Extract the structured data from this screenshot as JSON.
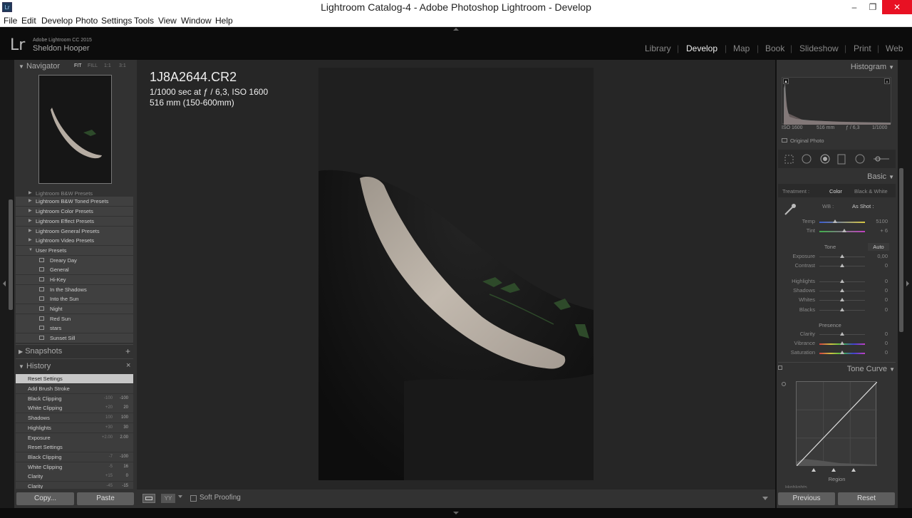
{
  "window": {
    "title": "Lightroom Catalog-4 - Adobe Photoshop Lightroom - Develop",
    "app_icon": "Lr",
    "minimize": "–",
    "maximize": "❐",
    "close": "✕"
  },
  "menu": [
    "File",
    "Edit",
    "Develop",
    "Photo",
    "Settings",
    "Tools",
    "View",
    "Window",
    "Help"
  ],
  "identity": {
    "logo": "Lr",
    "version": "Adobe Lightroom CC 2015",
    "user": "Sheldon Hooper"
  },
  "modules": [
    "Library",
    "Develop",
    "Map",
    "Book",
    "Slideshow",
    "Print",
    "Web"
  ],
  "navigator": {
    "title": "Navigator",
    "zoom": [
      "FIT",
      "FILL",
      "1:1",
      "3:1"
    ]
  },
  "presets": {
    "cut_top": "Lightroom B&W Presets",
    "folders": [
      "Lightroom B&W Toned Presets",
      "Lightroom Color Presets",
      "Lightroom Effect Presets",
      "Lightroom General Presets",
      "Lightroom Video Presets",
      "User Presets"
    ],
    "user": [
      "Dreary Day",
      "General",
      "Hi-Key",
      "In the Shadows",
      "Into the Sun",
      "Night",
      "Red Sun",
      "stars",
      "Sunset Sill"
    ]
  },
  "snapshots": {
    "title": "Snapshots",
    "add": "+"
  },
  "history": {
    "title": "History",
    "clear": "×",
    "items": [
      {
        "label": "Reset Settings",
        "v1": "",
        "v2": ""
      },
      {
        "label": "Add Brush Stroke",
        "v1": "",
        "v2": ""
      },
      {
        "label": "Black Clipping",
        "v1": "-100",
        "v2": "-100"
      },
      {
        "label": "White Clipping",
        "v1": "+20",
        "v2": "20"
      },
      {
        "label": "Shadows",
        "v1": "100",
        "v2": "100"
      },
      {
        "label": "Highlights",
        "v1": "+30",
        "v2": "30"
      },
      {
        "label": "Exposure",
        "v1": "+2.00",
        "v2": "2.00"
      },
      {
        "label": "Reset Settings",
        "v1": "",
        "v2": ""
      },
      {
        "label": "Black Clipping",
        "v1": "-7",
        "v2": "-100"
      },
      {
        "label": "White Clipping",
        "v1": "-5",
        "v2": "16"
      },
      {
        "label": "Clarity",
        "v1": "+15",
        "v2": "0"
      },
      {
        "label": "Clarity",
        "v1": "-45",
        "v2": "-15"
      }
    ]
  },
  "left_buttons": {
    "copy": "Copy...",
    "paste": "Paste"
  },
  "photo_info": {
    "filename": "1J8A2644.CR2",
    "exposure": "1/1000 sec at ƒ / 6,3, ISO 1600",
    "lens": "516 mm (150-600mm)"
  },
  "toolbar": {
    "soft_proofing": "Soft Proofing",
    "view_loupe": "loupe",
    "view_compare": "YY"
  },
  "histogram": {
    "title": "Histogram",
    "iso": "ISO 1600",
    "focal": "516 mm",
    "aperture": "ƒ / 6,3",
    "shutter": "1/1000",
    "original": "Original Photo"
  },
  "basic": {
    "title": "Basic",
    "treatment_label": "Treatment :",
    "color": "Color",
    "bw": "Black & White",
    "wb_label": "WB :",
    "wb_value": "As Shot :",
    "temp": {
      "label": "Temp",
      "value": "5100",
      "pos": 0.35
    },
    "tint": {
      "label": "Tint",
      "value": "+ 6",
      "pos": 0.55
    },
    "tone": "Tone",
    "auto": "Auto",
    "exposure": {
      "label": "Exposure",
      "value": "0,00",
      "pos": 0.5
    },
    "contrast": {
      "label": "Contrast",
      "value": "0",
      "pos": 0.5
    },
    "highlights": {
      "label": "Highlights",
      "value": "0",
      "pos": 0.5
    },
    "shadows": {
      "label": "Shadows",
      "value": "0",
      "pos": 0.5
    },
    "whites": {
      "label": "Whites",
      "value": "0",
      "pos": 0.5
    },
    "blacks": {
      "label": "Blacks",
      "value": "0",
      "pos": 0.5
    },
    "presence": "Presence",
    "clarity": {
      "label": "Clarity",
      "value": "0",
      "pos": 0.5
    },
    "vibrance": {
      "label": "Vibrance",
      "value": "0",
      "pos": 0.5
    },
    "saturation": {
      "label": "Saturation",
      "value": "0",
      "pos": 0.5
    }
  },
  "tone_curve": {
    "title": "Tone Curve",
    "region": "Region",
    "highlights_cut": "Highlights"
  },
  "right_buttons": {
    "previous": "Previous",
    "reset": "Reset"
  },
  "colors": {
    "panel": "#323232",
    "center": "#262626",
    "history_selected": "#c7c7c7",
    "close_red": "#e81123"
  }
}
